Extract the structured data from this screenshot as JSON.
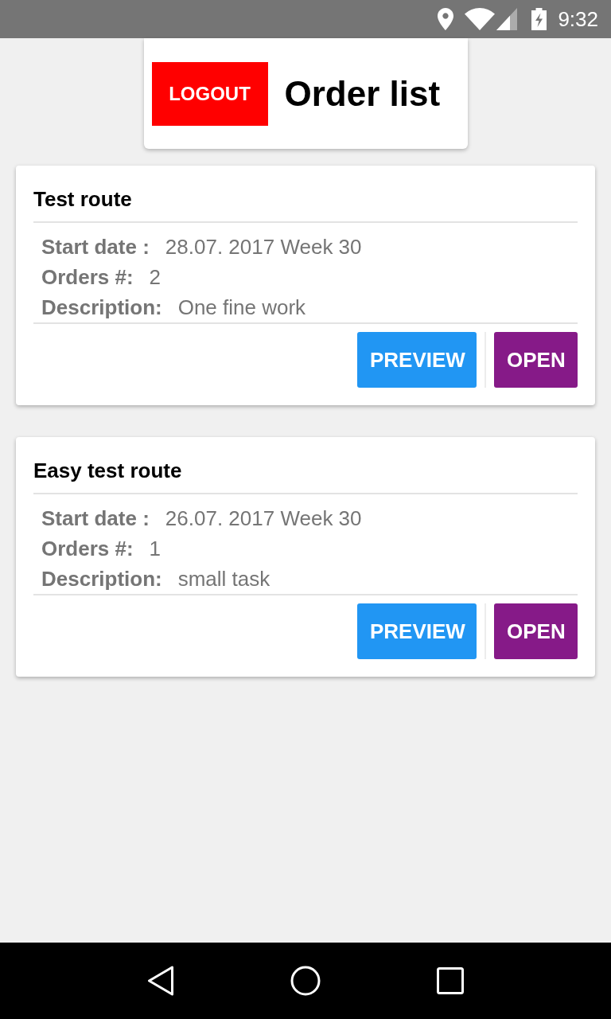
{
  "status_bar": {
    "time": "9:32"
  },
  "header": {
    "logout_button": "LOGOUT",
    "title": "Order list"
  },
  "routes": [
    {
      "title": "Test route",
      "fields": [
        {
          "label": "Start date :",
          "value": "28.07. 2017 Week 30"
        },
        {
          "label": "Orders #:",
          "value": "2"
        },
        {
          "label": "Description:",
          "value": "One fine work"
        }
      ],
      "buttons": [
        {
          "label": "PREVIEW",
          "kind": "preview"
        },
        {
          "label": "OPEN",
          "kind": "open"
        }
      ]
    },
    {
      "title": "Easy test route",
      "fields": [
        {
          "label": "Start date :",
          "value": "26.07. 2017 Week 30"
        },
        {
          "label": "Orders #:",
          "value": "1"
        },
        {
          "label": "Description:",
          "value": "small task"
        }
      ],
      "buttons": [
        {
          "label": "PREVIEW",
          "kind": "preview"
        },
        {
          "label": "OPEN",
          "kind": "open"
        }
      ]
    }
  ]
}
